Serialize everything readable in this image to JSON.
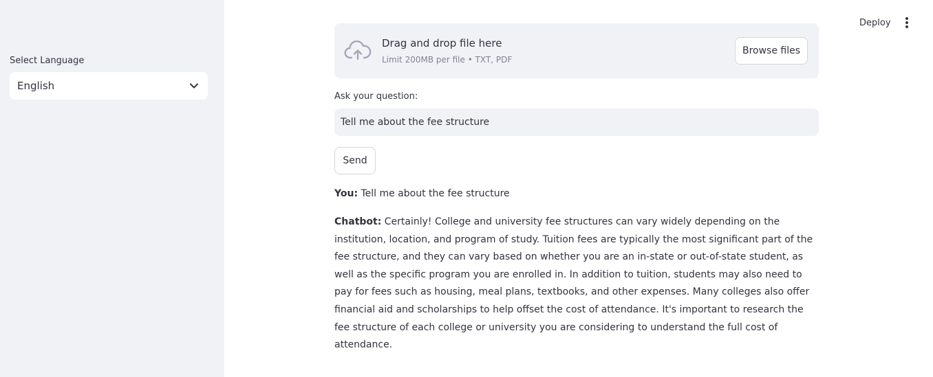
{
  "header": {
    "deploy_label": "Deploy",
    "menu_icon": "vertical-dots-icon"
  },
  "sidebar": {
    "language_label": "Select Language",
    "language_value": "English"
  },
  "uploader": {
    "drop_text": "Drag and drop file here",
    "limit_text": "Limit 200MB per file • TXT, PDF",
    "browse_label": "Browse files",
    "icon": "cloud-upload-icon"
  },
  "question": {
    "label": "Ask your question:",
    "value": "Tell me about the fee structure"
  },
  "send_label": "Send",
  "conversation": {
    "user_speaker": "You:",
    "user_text": "Tell me about the fee structure",
    "bot_speaker": "Chatbot:",
    "bot_text": "Certainly! College and university fee structures can vary widely depending on the institution, location, and program of study. Tuition fees are typically the most significant part of the fee structure, and they can vary based on whether you are an in-state or out-of-state student, as well as the specific program you are enrolled in. In addition to tuition, students may also need to pay for fees such as housing, meal plans, textbooks, and other expenses. Many colleges also offer financial aid and scholarships to help offset the cost of attendance. It's important to research the fee structure of each college or university you are considering to understand the full cost of attendance."
  },
  "colors": {
    "sidebar_bg": "#f0f2f6",
    "text": "#31333f",
    "muted": "#808495",
    "icon": "#a3a8b8"
  }
}
